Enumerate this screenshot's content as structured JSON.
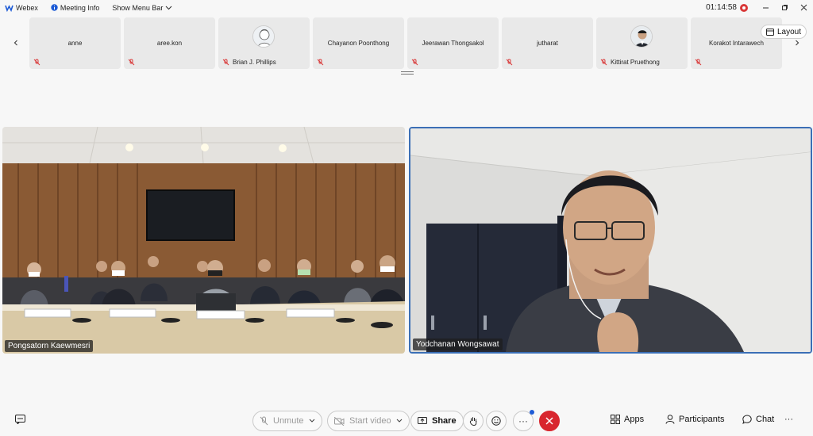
{
  "titlebar": {
    "app_name": "Webex",
    "meeting_info": "Meeting Info",
    "menu_toggle": "Show Menu Bar",
    "timer": "01:14:58"
  },
  "participants": [
    {
      "name": "anne",
      "has_avatar": false
    },
    {
      "name": "aree.kon",
      "has_avatar": false
    },
    {
      "name": "Brian J. Phillips",
      "has_avatar": true
    },
    {
      "name": "Chayanon Poonthong",
      "has_avatar": false
    },
    {
      "name": "Jeerawan Thongsakol",
      "has_avatar": false
    },
    {
      "name": "jutharat",
      "has_avatar": false
    },
    {
      "name": "Kittirat Pruethong",
      "has_avatar": true
    },
    {
      "name": "Korakot Intarawech",
      "has_avatar": false
    }
  ],
  "layout_button": "Layout",
  "videos": {
    "left_name": "Pongsatorn Kaewmesri",
    "right_name": "Yodchanan Wongsawat"
  },
  "controls": {
    "unmute": "Unmute",
    "start_video": "Start video",
    "share": "Share",
    "apps": "Apps",
    "participants": "Participants",
    "chat": "Chat"
  },
  "colors": {
    "end_call": "#d8262e",
    "active_speaker_border": "#3b6fb6",
    "mute_red": "#d93838"
  }
}
